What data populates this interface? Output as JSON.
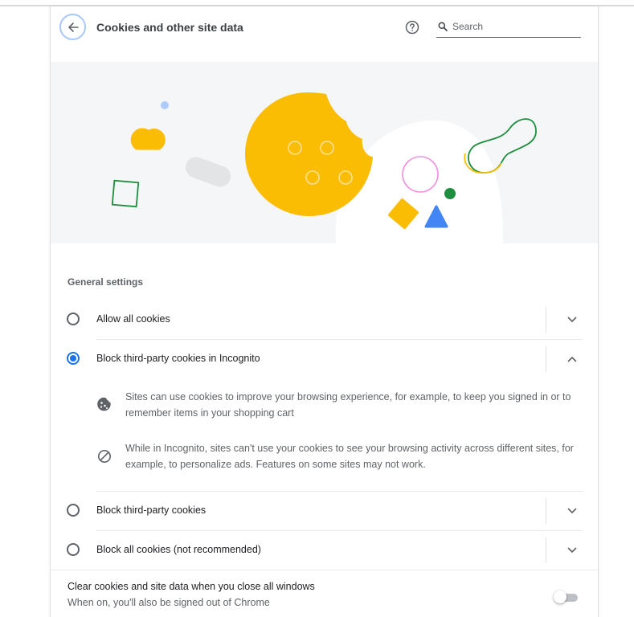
{
  "header": {
    "title": "Cookies and other site data",
    "back_icon": "arrow-back-icon",
    "help_icon": "help-circle-icon",
    "search": {
      "icon": "search-icon",
      "placeholder": "Search",
      "value": ""
    }
  },
  "general_settings": {
    "title": "General settings",
    "options": [
      {
        "label": "Allow all cookies",
        "selected": false,
        "expanded": false
      },
      {
        "label": "Block third-party cookies in Incognito",
        "selected": true,
        "expanded": true
      },
      {
        "label": "Block third-party cookies",
        "selected": false,
        "expanded": false
      },
      {
        "label": "Block all cookies (not recommended)",
        "selected": false,
        "expanded": false
      }
    ],
    "incognito_details": [
      {
        "icon": "cookie-icon",
        "text": "Sites can use cookies to improve your browsing experience, for example, to keep you signed in or to remember items in your shopping cart"
      },
      {
        "icon": "block-icon",
        "text": "While in Incognito, sites can't use your cookies to see your browsing activity across different sites, for example, to personalize ads. Features on some sites may not work."
      }
    ]
  },
  "clear_on_exit": {
    "title": "Clear cookies and site data when you close all windows",
    "subtitle": "When on, you'll also be signed out of Chrome",
    "enabled": false
  },
  "colors": {
    "accent": "#1a73e8",
    "cookie_yellow": "#fbbc04",
    "illustration_green": "#1e8e3e",
    "banner_bg": "#f5f6f7"
  }
}
